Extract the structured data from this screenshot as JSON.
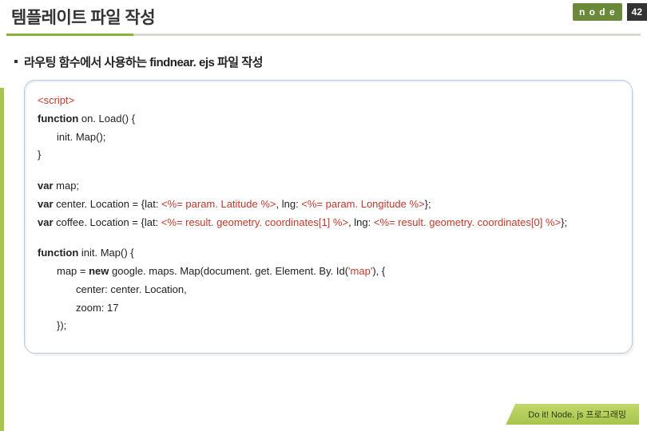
{
  "header": {
    "title": "템플레이트 파일 작성",
    "badge": "n o d e",
    "page": "42"
  },
  "subheading": "라우팅 함수에서 사용하는 findnear. ejs 파일 작성",
  "code": {
    "l1_open": "<script>",
    "l2a": "function",
    "l2b": " on. Load() {",
    "l3": "init. Map();",
    "l4": "}",
    "l5a": "var",
    "l5b": " map;",
    "l6a": "var",
    "l6b": " center. Location = {lat: ",
    "l6c": "<%= param. Latitude %>",
    "l6d": ", lng: ",
    "l6e": "<%= param. Longitude %>",
    "l6f": "};",
    "l7a": "var",
    "l7b": " coffee. Location = {lat: ",
    "l7c": "<%= result. geometry. coordinates[1] %>",
    "l7d": ", lng: ",
    "l7e": "<%= result. geometry. coordinates[0] %>",
    "l7f": "};",
    "l8a": "function",
    "l8b": " init. Map() {",
    "l9a": "map = ",
    "l9b": "new",
    "l9c": " google. maps. Map(document. get. Element. By. Id(",
    "l9d": "'map'",
    "l9e": "), {",
    "l10": "center: center. Location,",
    "l11": "zoom: 17",
    "l12": "});"
  },
  "footer": "Do it! Node. js 프로그래밍"
}
